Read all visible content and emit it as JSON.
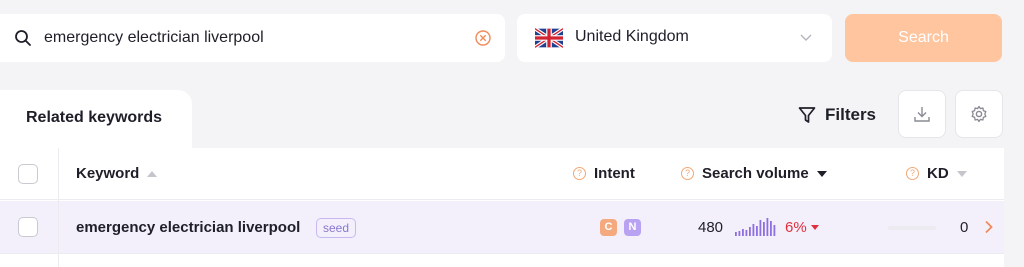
{
  "search": {
    "value": "emergency electrician liverpool",
    "button_label": "Search"
  },
  "country": {
    "selected": "United Kingdom"
  },
  "tabs": {
    "related_keywords": "Related keywords"
  },
  "toolbar": {
    "filters_label": "Filters"
  },
  "table": {
    "headers": {
      "keyword": "Keyword",
      "intent": "Intent",
      "search_volume": "Search volume",
      "kd": "KD"
    },
    "rows": [
      {
        "keyword": "emergency electrician liverpool",
        "badge": "seed",
        "intent": [
          "C",
          "N"
        ],
        "search_volume": "480",
        "trend_percent": "6%",
        "kd": "0"
      }
    ]
  },
  "colors": {
    "accent": "#ffc59e",
    "intent_c": "#f4a97f",
    "intent_n": "#b9a2f2",
    "trend_bars": "#8f6fe0",
    "negative": "#e0303e",
    "selected_row": "#f3f0fc"
  },
  "icons": {
    "search": "search-icon",
    "clear": "clear-circle-icon",
    "flag": "uk-flag-icon",
    "chevron": "chevron-down-icon",
    "filter": "funnel-icon",
    "export": "download-icon",
    "settings": "gear-icon",
    "row_open": "chevron-right-icon"
  }
}
